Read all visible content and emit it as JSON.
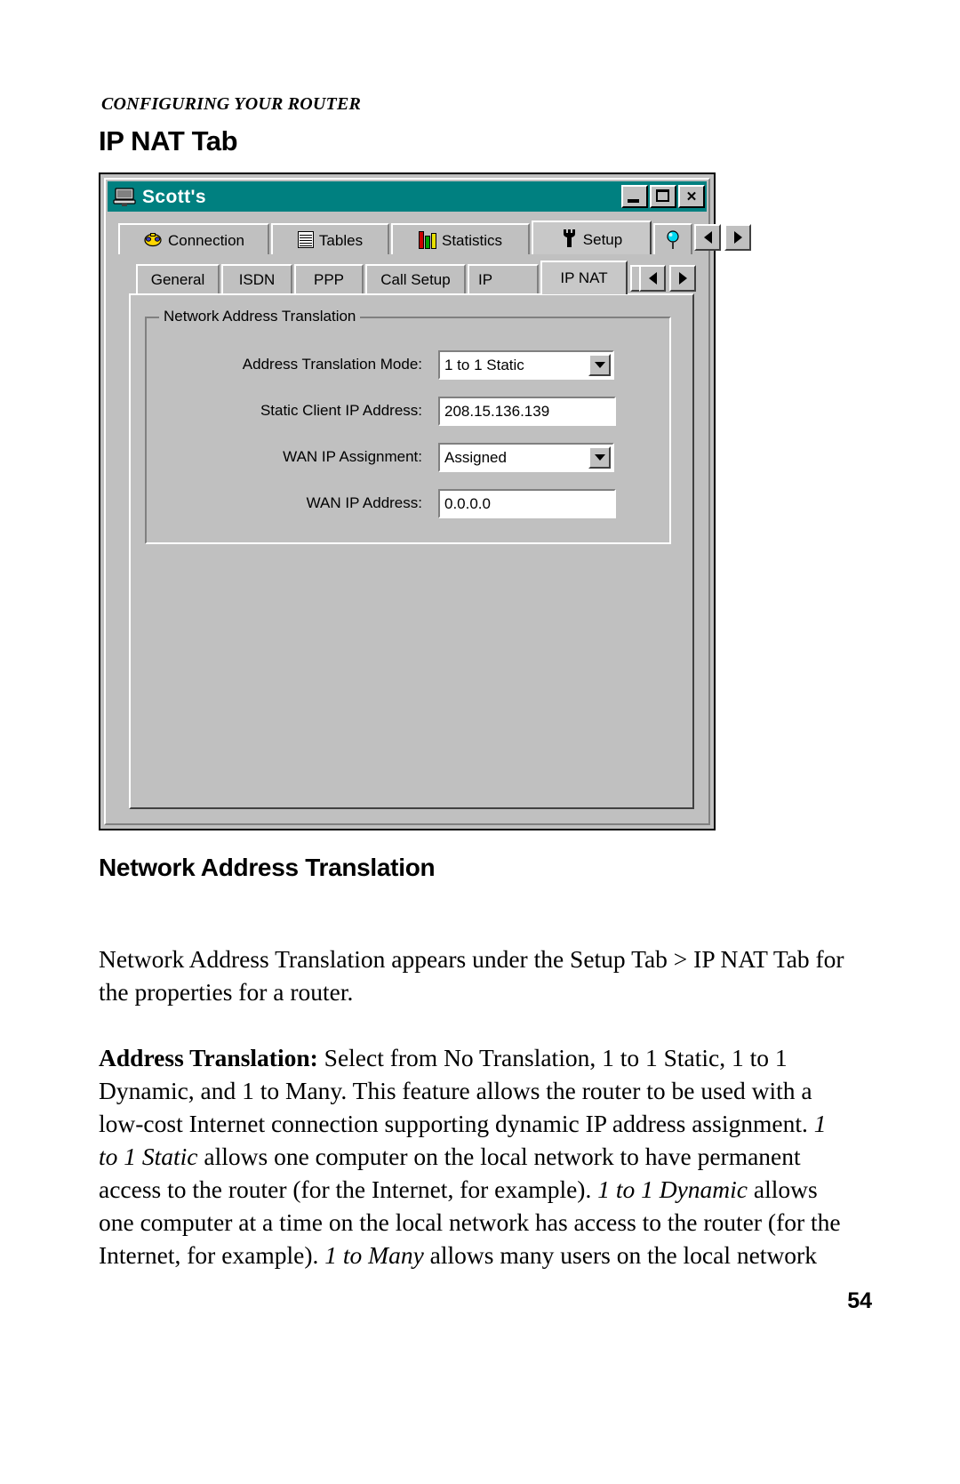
{
  "document": {
    "running_head": "CONFIGURING YOUR ROUTER",
    "section_title": "IP NAT Tab",
    "sub_heading": "Network Address Translation",
    "page_number": "54"
  },
  "screenshot": {
    "titlebar": {
      "title": "Scott's",
      "icon": "router-icon",
      "buttons": {
        "minimize": "_",
        "maximize": "□",
        "close": "✕"
      }
    },
    "main_tabs": [
      {
        "label": "Connection",
        "icon": "telephone-icon",
        "active": false
      },
      {
        "label": "Tables",
        "icon": "grid-table-icon",
        "active": false
      },
      {
        "label": "Statistics",
        "icon": "bar-chart-icon",
        "active": false
      },
      {
        "label": "Setup",
        "icon": "wrench-icon",
        "active": true
      },
      {
        "label": "",
        "icon": "pushpin-icon",
        "active": false
      }
    ],
    "main_tab_scroll": {
      "left": "◄",
      "right": "►"
    },
    "sub_tabs": [
      {
        "label": "General",
        "active": false
      },
      {
        "label": "ISDN",
        "active": false
      },
      {
        "label": "PPP",
        "active": false
      },
      {
        "label": "Call Setup",
        "active": false
      },
      {
        "label": "IP",
        "active": false
      },
      {
        "label": "IP NAT",
        "active": true
      }
    ],
    "sub_tab_scroll": {
      "left": "◄",
      "right": "►"
    },
    "group": {
      "title": "Network Address Translation",
      "fields": [
        {
          "label": "Address Translation Mode:",
          "value": "1 to 1 Static",
          "type": "combobox"
        },
        {
          "label": "Static Client IP Address:",
          "value": "208.15.136.139",
          "type": "textbox"
        },
        {
          "label": "WAN IP Assignment:",
          "value": "Assigned",
          "type": "combobox"
        },
        {
          "label": "WAN IP Address:",
          "value": "0.0.0.0",
          "type": "textbox"
        }
      ]
    },
    "colors": {
      "titlebar": "#008080",
      "face": "#c0c0c0",
      "field": "#ffffff"
    }
  },
  "body": {
    "paragraph_1": "Network Address Translation appears under the Setup Tab > IP NAT Tab for the properties for a router.",
    "paragraph_2": {
      "lead": "Address Translation:",
      "text_a": " Select from No Translation, 1 to 1 Static, 1 to 1 Dynamic, and 1 to Many. This feature allows the router to be used with a low-cost Internet connection supporting dynamic IP address assignment. ",
      "em_1": "1 to 1 Static",
      "text_b": " allows one computer on the local network to have permanent access to the router (for the Internet, for example). ",
      "em_2": "1 to 1 Dynamic",
      "text_c": " allows one computer at a time on the local network has access to the router (for the Internet, for example). ",
      "em_3": "1 to Many",
      "text_d": " allows many users on the local network"
    }
  }
}
